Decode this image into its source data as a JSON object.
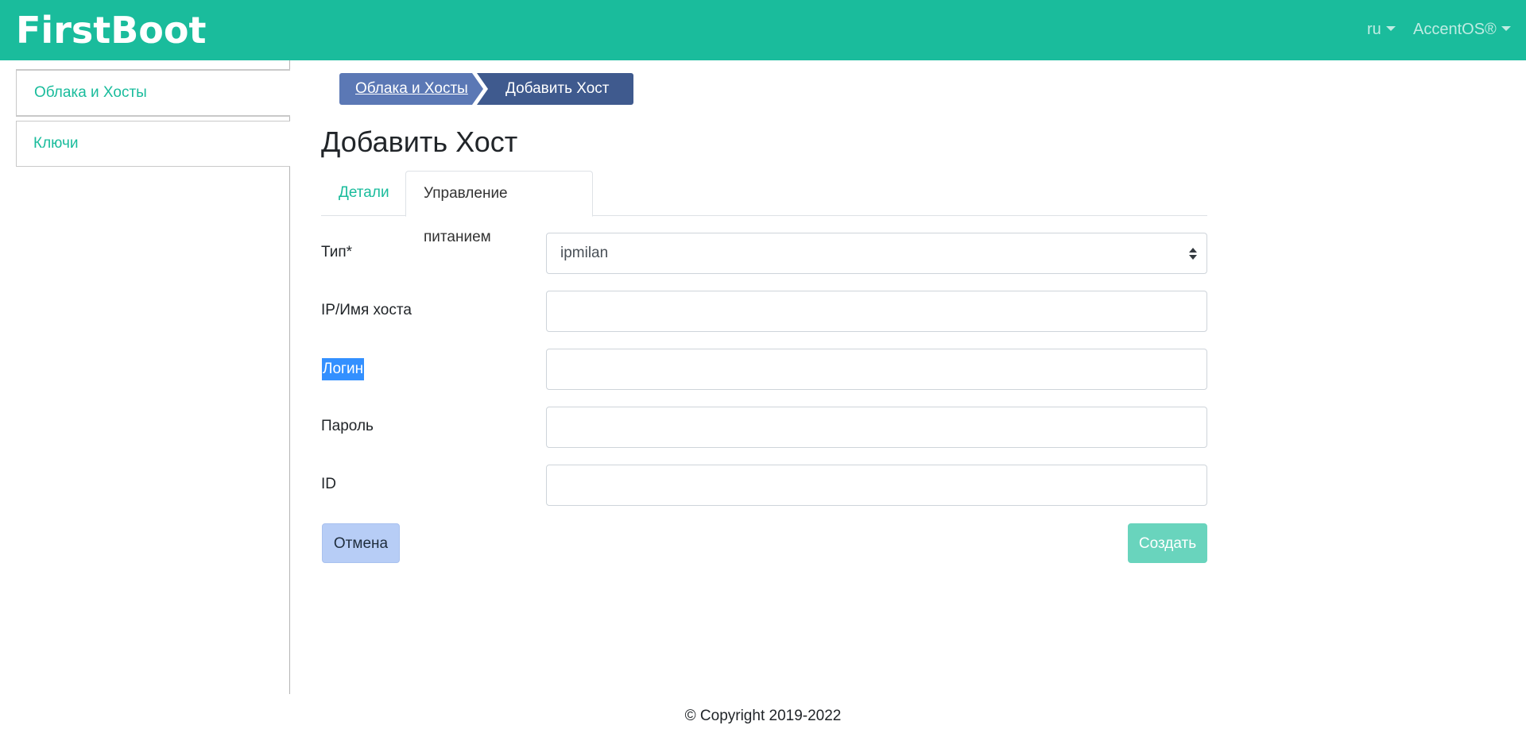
{
  "header": {
    "brand": "FirstBoot",
    "language": "ru",
    "user": "AccentOS®"
  },
  "sidebar": {
    "items": [
      {
        "label": "Облака и Хосты",
        "active": true
      },
      {
        "label": "Ключи",
        "active": false
      }
    ]
  },
  "breadcrumb": {
    "items": [
      "Облака и Хосты",
      "Добавить Хост"
    ]
  },
  "page": {
    "title": "Добавить Хост"
  },
  "tabs": {
    "items": [
      {
        "label": "Детали",
        "active": false
      },
      {
        "label": "Управление питанием",
        "active": true
      }
    ]
  },
  "form": {
    "type": {
      "label": "Тип*",
      "value": "ipmilan"
    },
    "host": {
      "label": "IP/Имя хоста",
      "value": ""
    },
    "login": {
      "label": "Логин",
      "value": ""
    },
    "password": {
      "label": "Пароль",
      "value": ""
    },
    "id": {
      "label": "ID",
      "value": ""
    }
  },
  "buttons": {
    "cancel": "Отмена",
    "create": "Создать"
  },
  "footer": {
    "copyright": "© Copyright 2019-2022"
  },
  "colors": {
    "primary": "#1abc9c",
    "breadcrumb_link": "#5b78b5",
    "breadcrumb_current": "#3f5a8e",
    "selection": "#3390ff"
  },
  "icons": {
    "caret": "caret-down-icon",
    "select": "select-arrows-icon"
  }
}
